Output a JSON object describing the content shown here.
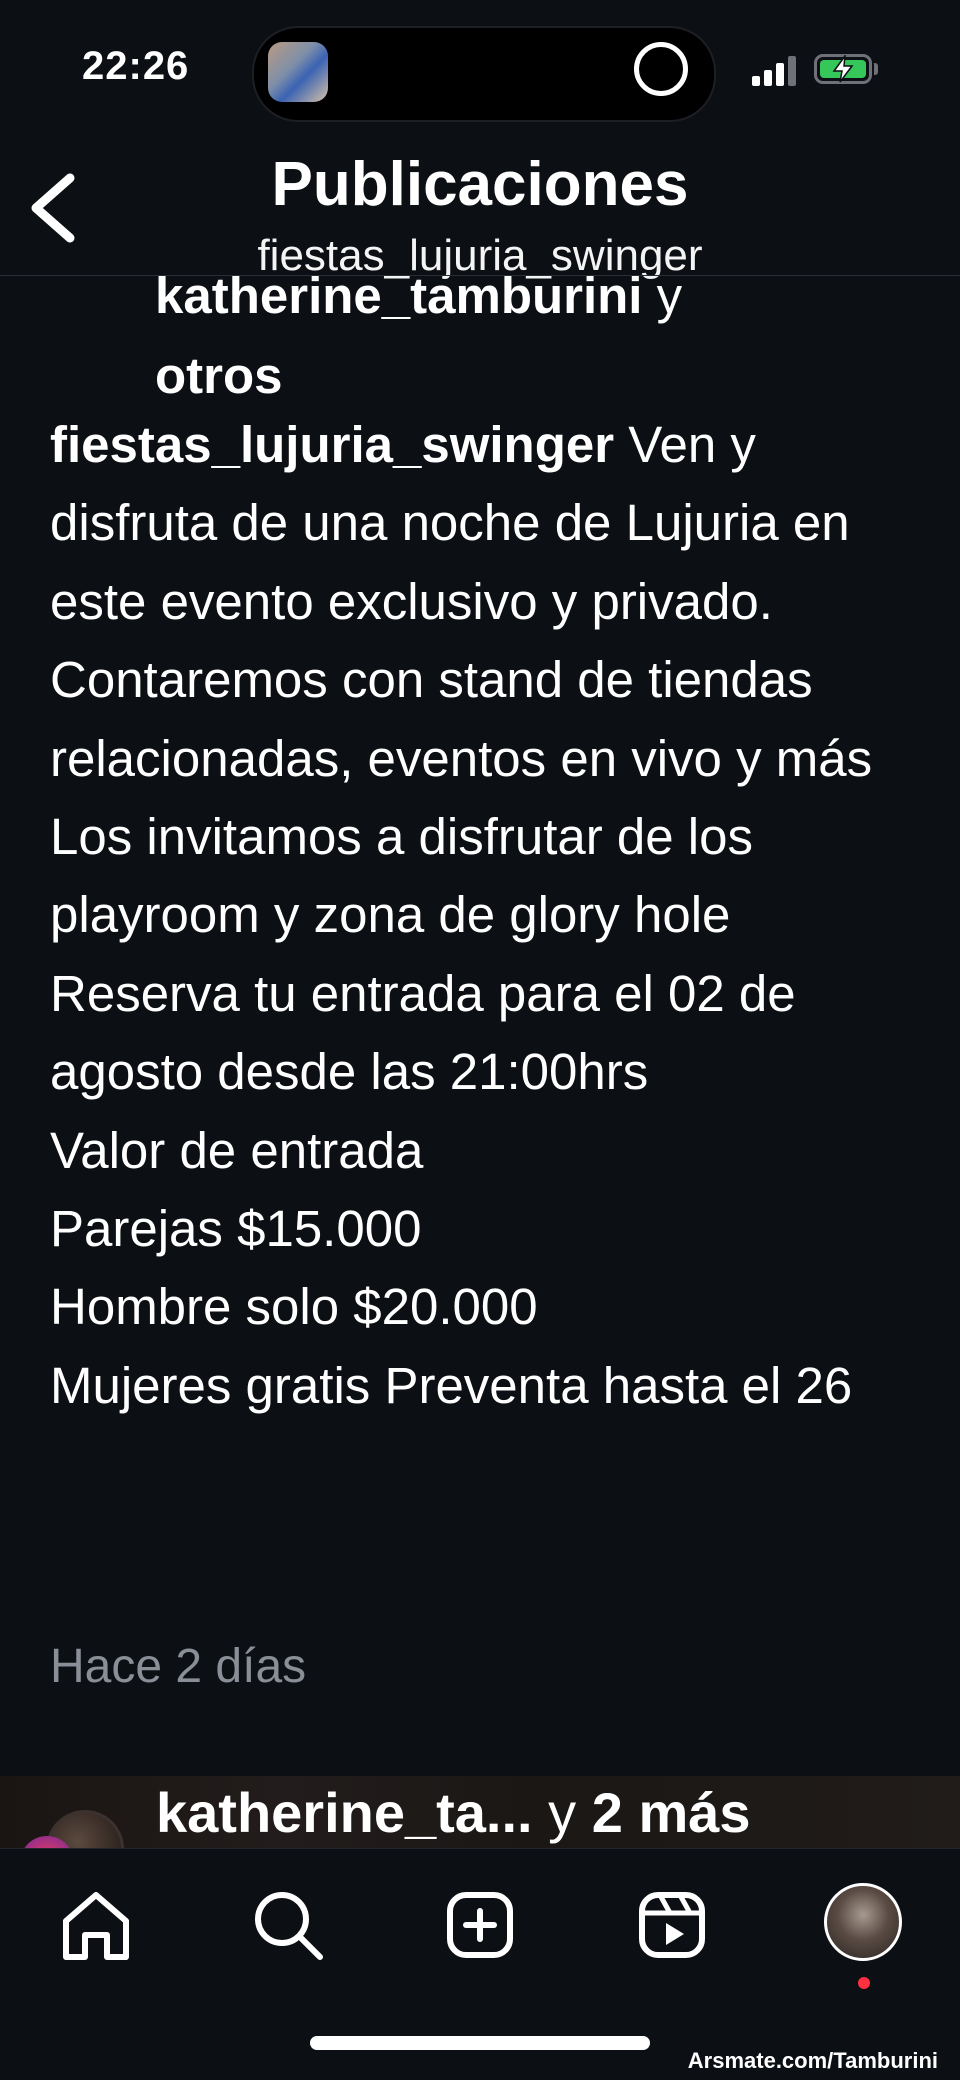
{
  "status_bar": {
    "time": "22:26"
  },
  "header": {
    "title": "Publicaciones",
    "subtitle": "fiestas_lujuria_swinger"
  },
  "post": {
    "likes_user": "katherine_tamburini",
    "likes_connector": " y",
    "likes_others": "otros",
    "caption_user": "fiestas_lujuria_swinger",
    "caption_text": " Ven y disfruta de una noche de Lujuria en este evento exclusivo y privado.\nContaremos con stand de tiendas relacionadas, eventos en vivo y más\nLos invitamos a disfrutar de los playroom y zona de glory hole\nReserva tu entrada para el 02 de agosto desde las 21:00hrs\nValor de entrada\nParejas $15.000\nHombre solo $20.000\nMujeres gratis Preventa hasta el 26",
    "timestamp": "Hace 2 días"
  },
  "next_post": {
    "users": "katherine_ta...",
    "connector": " y ",
    "more": "2 más"
  },
  "tab_bar": {
    "items": [
      {
        "icon": "home-icon"
      },
      {
        "icon": "search-icon"
      },
      {
        "icon": "create-icon"
      },
      {
        "icon": "reels-icon"
      },
      {
        "icon": "profile-avatar"
      }
    ]
  },
  "watermark": "Arsmate.com/Tamburini"
}
